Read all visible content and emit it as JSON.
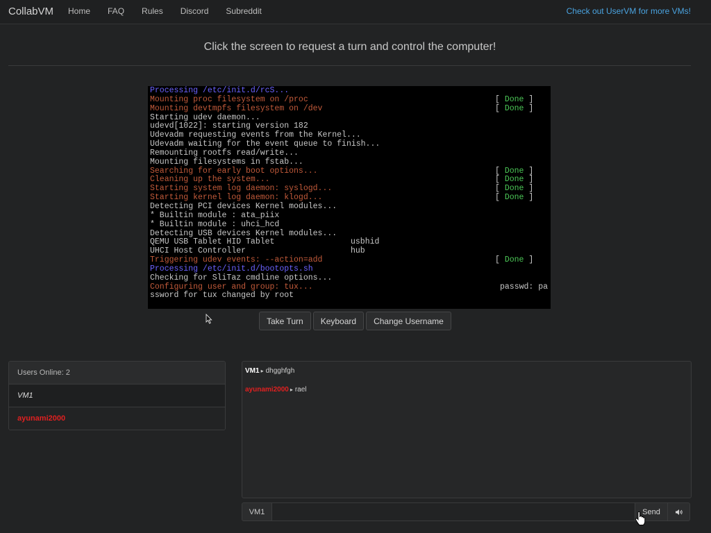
{
  "nav": {
    "brand": "CollabVM",
    "links": [
      "Home",
      "FAQ",
      "Rules",
      "Discord",
      "Subreddit"
    ],
    "right_link": "Check out UserVM for more VMs!"
  },
  "headline": "Click the screen to request a turn and control the computer!",
  "vm_screen": {
    "lines": [
      {
        "text": "Processing /etc/init.d/rcS...",
        "color": "blue"
      },
      {
        "text": "Mounting proc filesystem on /proc",
        "color": "orange",
        "status": "Done"
      },
      {
        "text": "Mounting devtmpfs filesystem on /dev",
        "color": "orange",
        "status": "Done"
      },
      {
        "text": "Starting udev daemon...",
        "color": "white"
      },
      {
        "text": "udevd[1022]: starting version 182",
        "color": "white"
      },
      {
        "text": "Udevadm requesting events from the Kernel...",
        "color": "white"
      },
      {
        "text": "Udevadm waiting for the event queue to finish...",
        "color": "white"
      },
      {
        "text": "Remounting rootfs read/write...",
        "color": "white"
      },
      {
        "text": "Mounting filesystems in fstab...",
        "color": "white"
      },
      {
        "text": "Searching for early boot options...",
        "color": "orange",
        "status": "Done"
      },
      {
        "text": "Cleaning up the system...",
        "color": "orange",
        "status": "Done"
      },
      {
        "text": "Starting system log daemon: syslogd...",
        "color": "orange",
        "status": "Done"
      },
      {
        "text": "Starting kernel log daemon: klogd...",
        "color": "orange",
        "status": "Done"
      },
      {
        "text": "Detecting PCI devices Kernel modules...",
        "color": "white"
      },
      {
        "text": "* Builtin module : ata_piix",
        "color": "white"
      },
      {
        "text": "* Builtin module : uhci_hcd",
        "color": "white"
      },
      {
        "text": "Detecting USB devices Kernel modules...",
        "color": "white"
      },
      {
        "text": "QEMU USB Tablet HID Tablet",
        "color": "white",
        "right1": "usbhid"
      },
      {
        "text": "UHCI Host Controller",
        "color": "white",
        "right1": "hub"
      },
      {
        "text": "Triggering udev events: --action=add",
        "color": "orange",
        "status": "Done"
      },
      {
        "text": "Processing /etc/init.d/bootopts.sh",
        "color": "blue"
      },
      {
        "text": "Checking for SliTaz cmdline options...",
        "color": "white"
      },
      {
        "text": "Configuring user and group: tux...",
        "color": "orange",
        "right2": "passwd: pa"
      },
      {
        "text": "ssword for tux changed by root",
        "color": "white"
      }
    ]
  },
  "controls": {
    "take_turn": "Take Turn",
    "keyboard": "Keyboard",
    "change_username": "Change Username"
  },
  "users": {
    "header": "Users Online: 2",
    "list": [
      {
        "name": "VM1",
        "style": "vm"
      },
      {
        "name": "ayunami2000",
        "style": "red"
      }
    ]
  },
  "chat": {
    "messages": [
      {
        "user": "VM1",
        "user_color": "white",
        "text": "dhgghfgh"
      },
      {
        "user": "ayunami2000",
        "user_color": "red",
        "text": "rael"
      }
    ],
    "input_addon": "VM1",
    "input_value": "",
    "input_placeholder": "",
    "send_label": "Send"
  },
  "colors": {
    "background": "#222324",
    "link": "#4aa3e0",
    "terminal_blue": "#6b62ff",
    "terminal_orange": "#c25a3a",
    "terminal_done": "#4cc957",
    "username_red": "#e02020"
  },
  "icons": {
    "volume": "volume-icon",
    "cursor": "mouse-pointer-icon",
    "hand": "hand-pointer-icon"
  }
}
